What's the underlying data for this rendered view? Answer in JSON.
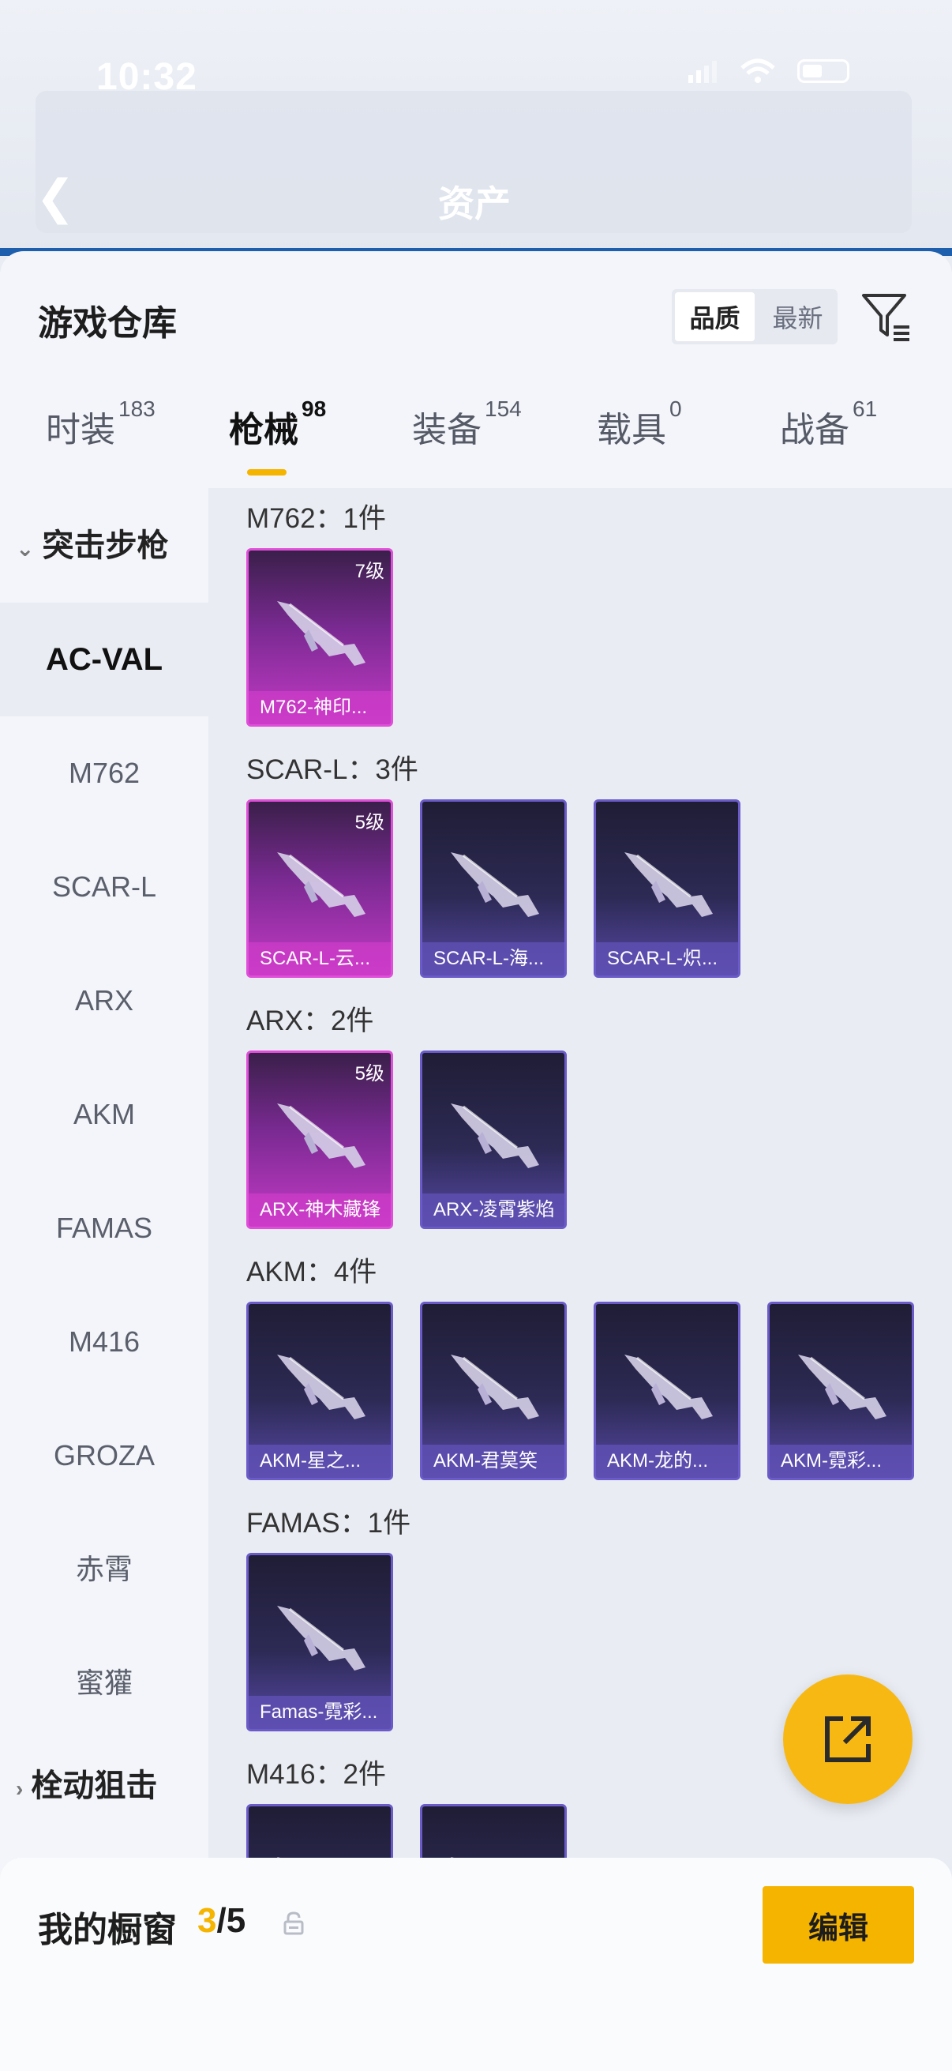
{
  "status": {
    "time": "10:32"
  },
  "header": {
    "page_title": "资产"
  },
  "sheet": {
    "title": "游戏仓库",
    "sort": [
      {
        "label": "品质"
      },
      {
        "label": "最新"
      }
    ],
    "tabs": [
      {
        "label": "时装",
        "count": "183"
      },
      {
        "label": "枪械",
        "count": "98"
      },
      {
        "label": "装备",
        "count": "154"
      },
      {
        "label": "载具",
        "count": "0"
      },
      {
        "label": "战备",
        "count": "61"
      }
    ]
  },
  "categories": {
    "group1": "突击步枪",
    "items": [
      "AC-VAL",
      "M762",
      "SCAR-L",
      "ARX",
      "AKM",
      "FAMAS",
      "M416",
      "GROZA",
      "赤霄",
      "蜜獾"
    ],
    "group2": "栓动狙击"
  },
  "sections": [
    {
      "title": "M762：1件",
      "cards": [
        {
          "name": "M762-神印...",
          "level": "7级",
          "rarity": "pink"
        }
      ]
    },
    {
      "title": "SCAR-L：3件",
      "cards": [
        {
          "name": "SCAR-L-云...",
          "level": "5级",
          "rarity": "pink"
        },
        {
          "name": "SCAR-L-海...",
          "level": "",
          "rarity": "purple"
        },
        {
          "name": "SCAR-L-炽...",
          "level": "",
          "rarity": "purple"
        }
      ]
    },
    {
      "title": "ARX：2件",
      "cards": [
        {
          "name": "ARX-神木藏锋",
          "level": "5级",
          "rarity": "pink"
        },
        {
          "name": "ARX-凌霄紫焰",
          "level": "",
          "rarity": "purple"
        }
      ]
    },
    {
      "title": "AKM：4件",
      "cards": [
        {
          "name": "AKM-星之...",
          "level": "",
          "rarity": "purple"
        },
        {
          "name": "AKM-君莫笑",
          "level": "",
          "rarity": "purple"
        },
        {
          "name": "AKM-龙的...",
          "level": "",
          "rarity": "purple"
        },
        {
          "name": "AKM-霓彩...",
          "level": "",
          "rarity": "purple"
        }
      ]
    },
    {
      "title": "FAMAS：1件",
      "cards": [
        {
          "name": "Famas-霓彩...",
          "level": "",
          "rarity": "purple"
        }
      ]
    },
    {
      "title": "M416：2件",
      "cards": []
    }
  ],
  "bottom": {
    "label": "我的橱窗",
    "current": "3",
    "total": "/5",
    "edit": "编辑"
  },
  "colors": {
    "accent": "#f5b400",
    "legendary": "#e04fd9",
    "epic": "#6a5bc9"
  }
}
